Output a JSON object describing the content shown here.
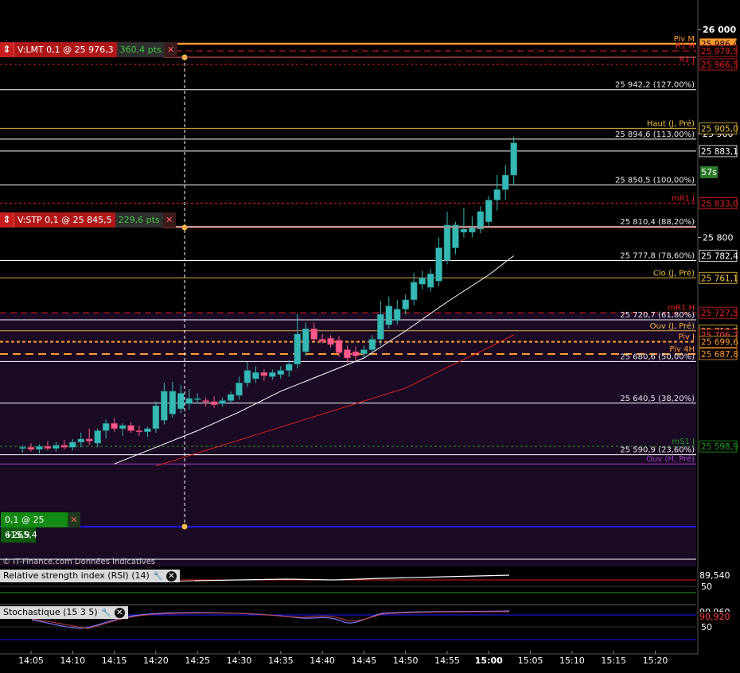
{
  "colors": {
    "background": "#000000",
    "shade": "#1a0a24",
    "candle_up": "#35b9b5",
    "candle_down": "#ff5a8a",
    "ma_fast": "#ffffff",
    "ma_slow": "#e02020",
    "pivot_orange": "#ff9a2e",
    "fib_white": "#ffffff",
    "resistance_red": "#e02020",
    "support_green": "#1f9a1f",
    "position_blue": "#1a1aff"
  },
  "orders": {
    "limit": {
      "label": "V:LMT  0,1 @ 25 976,3",
      "points": "360,4 pts",
      "icon": "double-arrow-icon"
    },
    "stop": {
      "label": "V:STP  0,1 @ 25 845,5",
      "points": "229,6 pts",
      "icon": "double-arrow-icon"
    },
    "position": {
      "label": "0,1 @ 25 615,9",
      "pnl": "+265,4"
    }
  },
  "watermark": "© IT-Finance.com Données indicatives",
  "countdown": "57s",
  "indicators": {
    "rsi": {
      "title": "Relative strength index (RSI) (14)",
      "value": "89,540",
      "level": "50"
    },
    "stoch": {
      "title": "Stochastique (15 3 5)",
      "value1": "90,960",
      "value2": "90,920",
      "level1": "90",
      "level2": "50"
    }
  },
  "chart_data": {
    "type": "candlestick",
    "y_range": [
      25580,
      26010
    ],
    "axis_ticks": [
      {
        "value": 26000,
        "label": "26 000"
      },
      {
        "value": 25900,
        "label": "25 900"
      },
      {
        "value": 25800,
        "label": "25 800"
      }
    ],
    "x_ticks": [
      "14:05",
      "14:10",
      "14:15",
      "14:20",
      "14:25",
      "14:30",
      "14:35",
      "14:40",
      "14:45",
      "14:50",
      "14:55",
      "15:00",
      "15:05",
      "15:10",
      "15:15",
      "15:20"
    ],
    "x_ticks_bold": [
      "15:00"
    ],
    "levels": [
      {
        "price": 25986.4,
        "name": "Piv M",
        "tag": "25 986,4",
        "kind": "pivot-month"
      },
      {
        "price": 25979.5,
        "name": "R1 H",
        "tag": "25 979,5",
        "kind": "resistance-dash"
      },
      {
        "price": 25966.5,
        "name": "R1 J",
        "tag": "25 966,5",
        "kind": "resistance-dot"
      },
      {
        "price": 25942.2,
        "name": "25 942,2 (127,00%)",
        "tag": "",
        "kind": "fib"
      },
      {
        "price": 25905.0,
        "name": "Haut (J, Pré)",
        "tag": "25 905,0",
        "kind": "prev-day"
      },
      {
        "price": 25894.6,
        "name": "25 894,6 (113,00%)",
        "tag": "",
        "kind": "fib"
      },
      {
        "price": 25883.1,
        "name": "",
        "tag": "25 883,1",
        "kind": "last"
      },
      {
        "price": 25850.5,
        "name": "25 850,5 (100,00%)",
        "tag": "",
        "kind": "fib"
      },
      {
        "price": 25833.0,
        "name": "mR1 J",
        "tag": "25 833,0",
        "kind": "resistance-dot"
      },
      {
        "price": 25810.4,
        "name": "25 810,4 (88,20%)",
        "tag": "",
        "kind": "fib"
      },
      {
        "price": 25782.4,
        "name": "",
        "tag": "25 782,4",
        "kind": "ma"
      },
      {
        "price": 25777.8,
        "name": "25 777,8 (78,60%)",
        "tag": "",
        "kind": "fib"
      },
      {
        "price": 25761.1,
        "name": "Clo (J, Pré)",
        "tag": "25 761,1",
        "kind": "prev-day"
      },
      {
        "price": 25727.5,
        "name": "mR1 H",
        "tag": "25 727,5",
        "kind": "resistance-dash"
      },
      {
        "price": 25720.7,
        "name": "25 720,7 (61,80%)",
        "tag": "",
        "kind": "fib"
      },
      {
        "price": 25710.2,
        "name": "Ouv (J, Pré)",
        "tag": "25 710,2",
        "kind": "prev-day"
      },
      {
        "price": 25706.2,
        "name": "",
        "tag": "25 706,2",
        "kind": "ma-slow"
      },
      {
        "price": 25699.6,
        "name": "Piv J",
        "tag": "25 699,6",
        "kind": "pivot-day"
      },
      {
        "price": 25687.8,
        "name": "Piv 4H",
        "tag": "25 687,8",
        "kind": "pivot-4h"
      },
      {
        "price": 25680.6,
        "name": "25 680,6 (50,00%)",
        "tag": "",
        "kind": "fib"
      },
      {
        "price": 25640.5,
        "name": "25 640,5 (38,20%)",
        "tag": "",
        "kind": "fib"
      },
      {
        "price": 25598.9,
        "name": "mS1 J",
        "tag": "25 598,9",
        "kind": "support"
      },
      {
        "price": 25590.9,
        "name": "25 590,9 (23,60%)",
        "tag": "",
        "kind": "fib"
      },
      {
        "price": 25582.0,
        "name": "Ouv (H, Pré)",
        "tag": "",
        "kind": "prev-hour"
      }
    ],
    "candles": [
      {
        "t": "14:04",
        "o": 25597,
        "h": 25600,
        "l": 25593,
        "c": 25598
      },
      {
        "t": "14:05",
        "o": 25598,
        "h": 25602,
        "l": 25594,
        "c": 25596
      },
      {
        "t": "14:06",
        "o": 25596,
        "h": 25601,
        "l": 25592,
        "c": 25599
      },
      {
        "t": "14:07",
        "o": 25599,
        "h": 25604,
        "l": 25595,
        "c": 25597
      },
      {
        "t": "14:08",
        "o": 25597,
        "h": 25603,
        "l": 25594,
        "c": 25600
      },
      {
        "t": "14:09",
        "o": 25600,
        "h": 25605,
        "l": 25596,
        "c": 25598
      },
      {
        "t": "14:10",
        "o": 25598,
        "h": 25606,
        "l": 25595,
        "c": 25603
      },
      {
        "t": "14:11",
        "o": 25603,
        "h": 25612,
        "l": 25598,
        "c": 25606
      },
      {
        "t": "14:12",
        "o": 25606,
        "h": 25616,
        "l": 25600,
        "c": 25604
      },
      {
        "t": "14:13",
        "o": 25602,
        "h": 25616,
        "l": 25598,
        "c": 25614
      },
      {
        "t": "14:14",
        "o": 25614,
        "h": 25625,
        "l": 25606,
        "c": 25621
      },
      {
        "t": "14:15",
        "o": 25621,
        "h": 25626,
        "l": 25613,
        "c": 25616
      },
      {
        "t": "14:16",
        "o": 25616,
        "h": 25621,
        "l": 25609,
        "c": 25619
      },
      {
        "t": "14:17",
        "o": 25619,
        "h": 25622,
        "l": 25612,
        "c": 25614
      },
      {
        "t": "14:18",
        "o": 25614,
        "h": 25619,
        "l": 25609,
        "c": 25613
      },
      {
        "t": "14:19",
        "o": 25613,
        "h": 25618,
        "l": 25608,
        "c": 25616
      },
      {
        "t": "14:20",
        "o": 25616,
        "h": 25642,
        "l": 25612,
        "c": 25638
      },
      {
        "t": "14:21",
        "o": 25624,
        "h": 25660,
        "l": 25620,
        "c": 25652
      },
      {
        "t": "14:22",
        "o": 25630,
        "h": 25661,
        "l": 25626,
        "c": 25652
      },
      {
        "t": "14:23",
        "o": 25635,
        "h": 25658,
        "l": 25631,
        "c": 25650
      },
      {
        "t": "14:24",
        "o": 25640,
        "h": 25654,
        "l": 25634,
        "c": 25645
      },
      {
        "t": "14:25",
        "o": 25645,
        "h": 25650,
        "l": 25640,
        "c": 25645
      },
      {
        "t": "14:26",
        "o": 25643,
        "h": 25646,
        "l": 25637,
        "c": 25642
      },
      {
        "t": "14:27",
        "o": 25642,
        "h": 25647,
        "l": 25636,
        "c": 25639
      },
      {
        "t": "14:28",
        "o": 25640,
        "h": 25646,
        "l": 25637,
        "c": 25643
      },
      {
        "t": "14:29",
        "o": 25643,
        "h": 25652,
        "l": 25640,
        "c": 25649
      },
      {
        "t": "14:30",
        "o": 25648,
        "h": 25666,
        "l": 25644,
        "c": 25660
      },
      {
        "t": "14:31",
        "o": 25660,
        "h": 25680,
        "l": 25656,
        "c": 25672
      },
      {
        "t": "14:32",
        "o": 25664,
        "h": 25676,
        "l": 25660,
        "c": 25670
      },
      {
        "t": "14:33",
        "o": 25670,
        "h": 25673,
        "l": 25662,
        "c": 25667
      },
      {
        "t": "14:34",
        "o": 25666,
        "h": 25673,
        "l": 25663,
        "c": 25670
      },
      {
        "t": "14:35",
        "o": 25668,
        "h": 25676,
        "l": 25664,
        "c": 25672
      },
      {
        "t": "14:36",
        "o": 25672,
        "h": 25682,
        "l": 25666,
        "c": 25678
      },
      {
        "t": "14:37",
        "o": 25678,
        "h": 25726,
        "l": 25674,
        "c": 25707
      },
      {
        "t": "14:38",
        "o": 25690,
        "h": 25718,
        "l": 25686,
        "c": 25712
      },
      {
        "t": "14:39",
        "o": 25712,
        "h": 25718,
        "l": 25700,
        "c": 25702
      },
      {
        "t": "14:40",
        "o": 25702,
        "h": 25707,
        "l": 25698,
        "c": 25700
      },
      {
        "t": "14:41",
        "o": 25703,
        "h": 25706,
        "l": 25694,
        "c": 25697
      },
      {
        "t": "14:42",
        "o": 25701,
        "h": 25705,
        "l": 25685,
        "c": 25689
      },
      {
        "t": "14:43",
        "o": 25692,
        "h": 25696,
        "l": 25679,
        "c": 25684
      },
      {
        "t": "14:44",
        "o": 25690,
        "h": 25695,
        "l": 25682,
        "c": 25686
      },
      {
        "t": "14:45",
        "o": 25688,
        "h": 25696,
        "l": 25684,
        "c": 25692
      },
      {
        "t": "14:46",
        "o": 25692,
        "h": 25706,
        "l": 25689,
        "c": 25702
      },
      {
        "t": "14:47",
        "o": 25702,
        "h": 25739,
        "l": 25696,
        "c": 25726
      },
      {
        "t": "14:48",
        "o": 25716,
        "h": 25743,
        "l": 25712,
        "c": 25734
      },
      {
        "t": "14:49",
        "o": 25720,
        "h": 25740,
        "l": 25716,
        "c": 25731
      },
      {
        "t": "14:50",
        "o": 25731,
        "h": 25745,
        "l": 25726,
        "c": 25740
      },
      {
        "t": "14:51",
        "o": 25740,
        "h": 25766,
        "l": 25735,
        "c": 25757
      },
      {
        "t": "14:52",
        "o": 25755,
        "h": 25768,
        "l": 25750,
        "c": 25761
      },
      {
        "t": "14:53",
        "o": 25752,
        "h": 25770,
        "l": 25748,
        "c": 25765
      },
      {
        "t": "14:54",
        "o": 25758,
        "h": 25800,
        "l": 25753,
        "c": 25790
      },
      {
        "t": "14:55",
        "o": 25778,
        "h": 25825,
        "l": 25774,
        "c": 25812
      },
      {
        "t": "14:56",
        "o": 25790,
        "h": 25815,
        "l": 25784,
        "c": 25812
      },
      {
        "t": "14:57",
        "o": 25805,
        "h": 25828,
        "l": 25800,
        "c": 25808
      },
      {
        "t": "14:58",
        "o": 25805,
        "h": 25820,
        "l": 25800,
        "c": 25810
      },
      {
        "t": "14:59",
        "o": 25808,
        "h": 25830,
        "l": 25804,
        "c": 25825
      },
      {
        "t": "15:00",
        "o": 25815,
        "h": 25840,
        "l": 25810,
        "c": 25836
      },
      {
        "t": "15:01",
        "o": 25836,
        "h": 25860,
        "l": 25826,
        "c": 25846
      },
      {
        "t": "15:02",
        "o": 25846,
        "h": 25870,
        "l": 25836,
        "c": 25860
      },
      {
        "t": "15:03",
        "o": 25860,
        "h": 25897,
        "l": 25850,
        "c": 25891
      }
    ],
    "ma_fast": [
      {
        "t": "14:15",
        "v": 25582
      },
      {
        "t": "14:20",
        "v": 25598
      },
      {
        "t": "14:25",
        "v": 25614
      },
      {
        "t": "14:30",
        "v": 25632
      },
      {
        "t": "14:35",
        "v": 25652
      },
      {
        "t": "14:40",
        "v": 25668
      },
      {
        "t": "14:45",
        "v": 25684
      },
      {
        "t": "14:50",
        "v": 25710
      },
      {
        "t": "14:55",
        "v": 25738
      },
      {
        "t": "15:00",
        "v": 25764
      },
      {
        "t": "15:03",
        "v": 25782.4
      }
    ],
    "ma_slow": [
      {
        "t": "14:20",
        "v": 25580
      },
      {
        "t": "14:30",
        "v": 25605
      },
      {
        "t": "14:40",
        "v": 25630
      },
      {
        "t": "14:50",
        "v": 25655
      },
      {
        "t": "14:55",
        "v": 25675
      },
      {
        "t": "15:00",
        "v": 25694
      },
      {
        "t": "15:03",
        "v": 25706.2
      }
    ]
  }
}
